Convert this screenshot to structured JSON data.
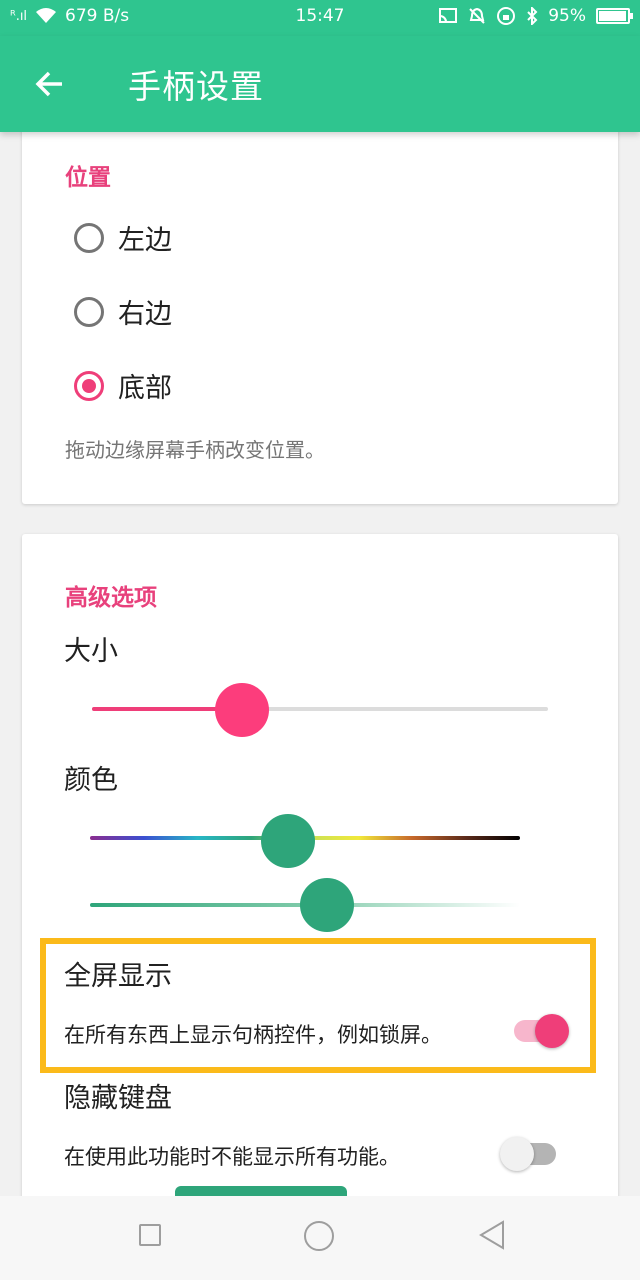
{
  "status_bar": {
    "signal": "ᴿ.ıl",
    "speed": "679 B/s",
    "time": "15:47",
    "battery": "95%"
  },
  "toolbar": {
    "title": "手柄设置"
  },
  "position_section": {
    "title": "位置",
    "options": [
      {
        "label": "左边",
        "checked": false
      },
      {
        "label": "右边",
        "checked": false
      },
      {
        "label": "底部",
        "checked": true
      }
    ],
    "hint": "拖动边缘屏幕手柄改变位置。"
  },
  "advanced_section": {
    "title": "高级选项",
    "size_label": "大小",
    "size_value": 0.33,
    "color_label": "颜色",
    "hue_value": 0.46,
    "saturation_value": 0.55,
    "fullscreen": {
      "title": "全屏显示",
      "desc": "在所有东西上显示句柄控件，例如锁屏。",
      "enabled": true
    },
    "hide_keyboard": {
      "title": "隐藏键盘",
      "desc": "在使用此功能时不能显示所有功能。",
      "enabled": false
    }
  },
  "colors": {
    "primary": "#2fc58f",
    "accent": "#ef3e79",
    "highlight": "#fbba1a"
  }
}
